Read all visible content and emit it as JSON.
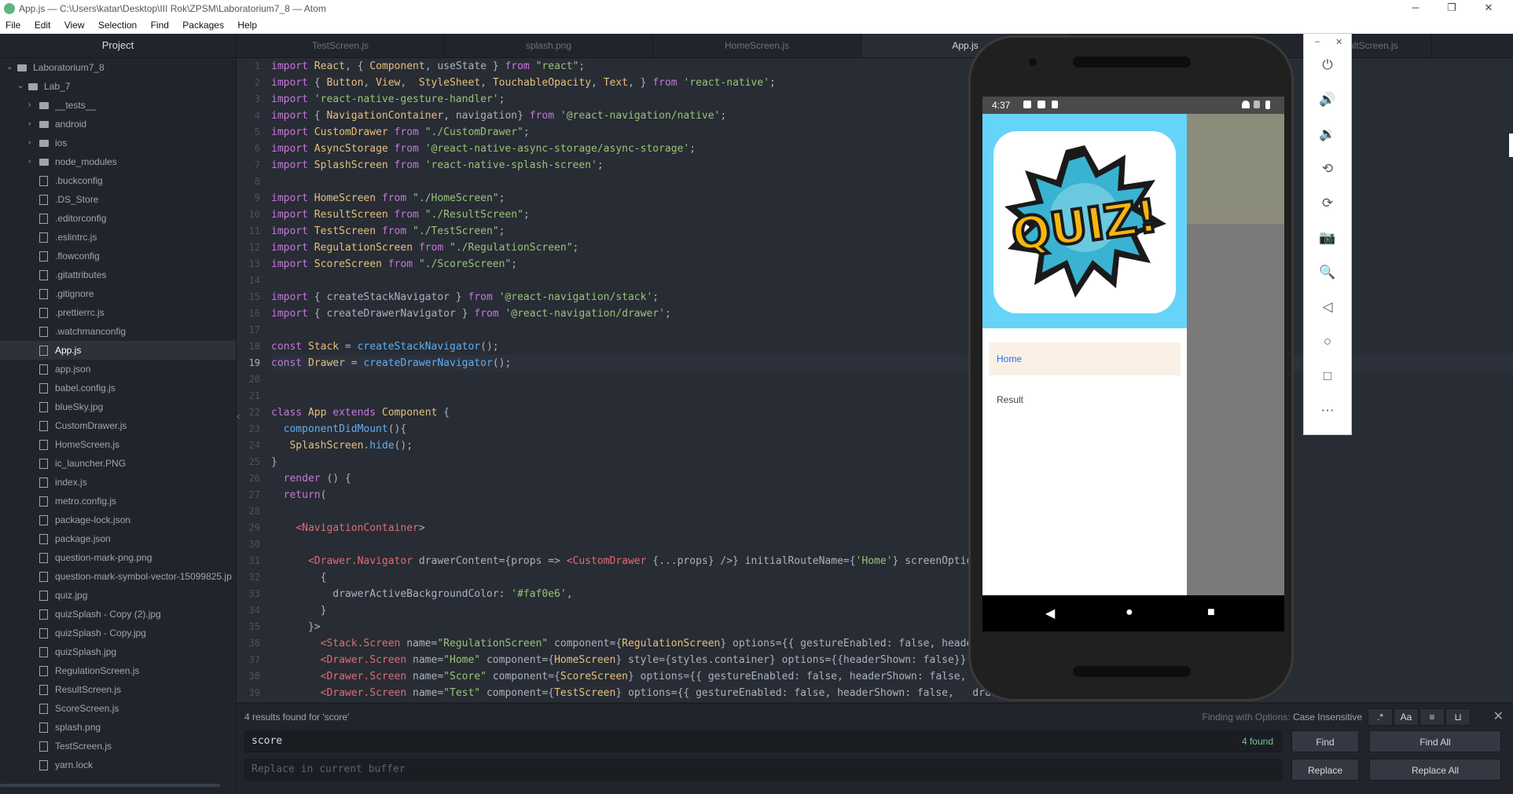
{
  "window": {
    "title": "App.js — C:\\Users\\katar\\Desktop\\III Rok\\ZPSM\\Laboratorium7_8 — Atom",
    "minimize": "─",
    "maximize": "❐",
    "close": "✕"
  },
  "menu": [
    "File",
    "Edit",
    "View",
    "Selection",
    "Find",
    "Packages",
    "Help"
  ],
  "tree": {
    "header": "Project",
    "items": [
      {
        "label": "Laboratorium7_8",
        "type": "folder",
        "depth": 0,
        "open": true
      },
      {
        "label": "Lab_7",
        "type": "folder",
        "depth": 1,
        "open": true
      },
      {
        "label": "__tests__",
        "type": "folder",
        "depth": 2,
        "open": false
      },
      {
        "label": "android",
        "type": "folder",
        "depth": 2,
        "open": false
      },
      {
        "label": "ios",
        "type": "folder",
        "depth": 2,
        "open": false
      },
      {
        "label": "node_modules",
        "type": "folder",
        "depth": 2,
        "open": false
      },
      {
        "label": ".buckconfig",
        "type": "file",
        "depth": 2
      },
      {
        "label": ".DS_Store",
        "type": "file",
        "depth": 2
      },
      {
        "label": ".editorconfig",
        "type": "file",
        "depth": 2
      },
      {
        "label": ".eslintrc.js",
        "type": "file",
        "depth": 2
      },
      {
        "label": ".flowconfig",
        "type": "file",
        "depth": 2
      },
      {
        "label": ".gitattributes",
        "type": "file",
        "depth": 2
      },
      {
        "label": ".gitignore",
        "type": "file",
        "depth": 2
      },
      {
        "label": ".prettierrc.js",
        "type": "file",
        "depth": 2
      },
      {
        "label": ".watchmanconfig",
        "type": "file",
        "depth": 2
      },
      {
        "label": "App.js",
        "type": "file",
        "depth": 2,
        "selected": true
      },
      {
        "label": "app.json",
        "type": "file",
        "depth": 2
      },
      {
        "label": "babel.config.js",
        "type": "file",
        "depth": 2
      },
      {
        "label": "blueSky.jpg",
        "type": "file",
        "depth": 2
      },
      {
        "label": "CustomDrawer.js",
        "type": "file",
        "depth": 2
      },
      {
        "label": "HomeScreen.js",
        "type": "file",
        "depth": 2
      },
      {
        "label": "ic_launcher.PNG",
        "type": "file",
        "depth": 2
      },
      {
        "label": "index.js",
        "type": "file",
        "depth": 2
      },
      {
        "label": "metro.config.js",
        "type": "file",
        "depth": 2
      },
      {
        "label": "package-lock.json",
        "type": "file",
        "depth": 2
      },
      {
        "label": "package.json",
        "type": "file",
        "depth": 2
      },
      {
        "label": "question-mark-png.png",
        "type": "file",
        "depth": 2
      },
      {
        "label": "question-mark-symbol-vector-15099825.jp",
        "type": "file",
        "depth": 2
      },
      {
        "label": "quiz.jpg",
        "type": "file",
        "depth": 2
      },
      {
        "label": "quizSplash - Copy (2).jpg",
        "type": "file",
        "depth": 2
      },
      {
        "label": "quizSplash - Copy.jpg",
        "type": "file",
        "depth": 2
      },
      {
        "label": "quizSplash.jpg",
        "type": "file",
        "depth": 2
      },
      {
        "label": "RegulationScreen.js",
        "type": "file",
        "depth": 2
      },
      {
        "label": "ResultScreen.js",
        "type": "file",
        "depth": 2
      },
      {
        "label": "ScoreScreen.js",
        "type": "file",
        "depth": 2
      },
      {
        "label": "splash.png",
        "type": "file",
        "depth": 2
      },
      {
        "label": "TestScreen.js",
        "type": "file",
        "depth": 2
      },
      {
        "label": "yarn.lock",
        "type": "file",
        "depth": 2
      }
    ]
  },
  "tabs": [
    {
      "label": "TestScreen.js",
      "active": false
    },
    {
      "label": "splash.png",
      "active": false
    },
    {
      "label": "HomeScreen.js",
      "active": false
    },
    {
      "label": "App.js",
      "active": true
    },
    {
      "label": "esultScreen.js",
      "active": false
    }
  ],
  "editor": {
    "current_line": 19,
    "line_numbers": [
      "1",
      "2",
      "3",
      "4",
      "5",
      "6",
      "7",
      "8",
      "9",
      "10",
      "11",
      "12",
      "13",
      "14",
      "15",
      "16",
      "17",
      "18",
      "19",
      "20",
      "21",
      "22",
      "23",
      "24",
      "25",
      "26",
      "27",
      "28",
      "29",
      "30",
      "31",
      "32",
      "33",
      "34",
      "35",
      "36",
      "37",
      "38",
      "39"
    ],
    "lines": [
      "import React, { Component, useState } from \"react\";",
      "import { Button, View,  StyleSheet, TouchableOpacity, Text, } from 'react-native';",
      "import 'react-native-gesture-handler';",
      "import { NavigationContainer, navigation} from '@react-navigation/native';",
      "import CustomDrawer from \"./CustomDrawer\";",
      "import AsyncStorage from '@react-native-async-storage/async-storage';",
      "import SplashScreen from 'react-native-splash-screen';",
      "",
      "import HomeScreen from \"./HomeScreen\";",
      "import ResultScreen from \"./ResultScreen\";",
      "import TestScreen from \"./TestScreen\";",
      "import RegulationScreen from \"./RegulationScreen\";",
      "import ScoreScreen from \"./ScoreScreen\";",
      "",
      "import { createStackNavigator } from '@react-navigation/stack';",
      "import { createDrawerNavigator } from '@react-navigation/drawer';",
      "",
      "const Stack = createStackNavigator();",
      "const Drawer = createDrawerNavigator();",
      "",
      "",
      "class App extends Component {",
      "  componentDidMount(){",
      "   SplashScreen.hide();",
      "}",
      "  render () {",
      "  return(",
      "",
      "    <NavigationContainer>",
      "",
      "      <Drawer.Navigator drawerContent={props => <CustomDrawer {...props} />} initialRouteName={'Home'} screenOption",
      "        {",
      "          drawerActiveBackgroundColor: '#faf0e6',",
      "        }",
      "      }>",
      "        <Stack.Screen name=\"RegulationScreen\" component={RegulationScreen} options={{ gestureEnabled: false, header",
      "        <Drawer.Screen name=\"Home\" component={HomeScreen} style={styles.container} options={{headerShown: false}} /",
      "        <Drawer.Screen name=\"Score\" component={ScoreScreen} options={{ gestureEnabled: false, headerShown: false,",
      "        <Drawer.Screen name=\"Test\" component={TestScreen} options={{ gestureEnabled: false, headerShown: false,   draw"
    ]
  },
  "find": {
    "results_text": "4 results found for 'score'",
    "options_label": "Finding with Options:",
    "options_value": "Case Insensitive",
    "opt_regex": ".*",
    "opt_case": "Aa",
    "find_value": "score",
    "found_count": "4 found",
    "replace_placeholder": "Replace in current buffer",
    "find_btn": "Find",
    "find_all_btn": "Find All",
    "replace_btn": "Replace",
    "replace_all_btn": "Replace All",
    "close": "✕"
  },
  "emulator": {
    "status_time": "4:37",
    "logo_text": "QUIZ!",
    "drawer_items": [
      {
        "label": "Home",
        "active": true
      },
      {
        "label": "Result",
        "active": false
      }
    ],
    "active_bg": "#faf0e6",
    "header_bg": "#66d4f8",
    "nav": {
      "back": "◀",
      "home": "●",
      "recents": "■"
    },
    "panel_min": "–",
    "panel_close": "✕",
    "panel_buttons": [
      "power-icon",
      "volume-up-icon",
      "volume-down-icon",
      "rotate-left-icon",
      "rotate-right-icon",
      "camera-icon",
      "zoom-icon",
      "back-icon",
      "home-icon",
      "overview-icon",
      "more-icon"
    ],
    "panel_glyphs": [
      "⏻",
      "🔊",
      "🔉",
      "⟲",
      "⟳",
      "📷",
      "🔍",
      "◁",
      "○",
      "□",
      "⋯"
    ]
  }
}
